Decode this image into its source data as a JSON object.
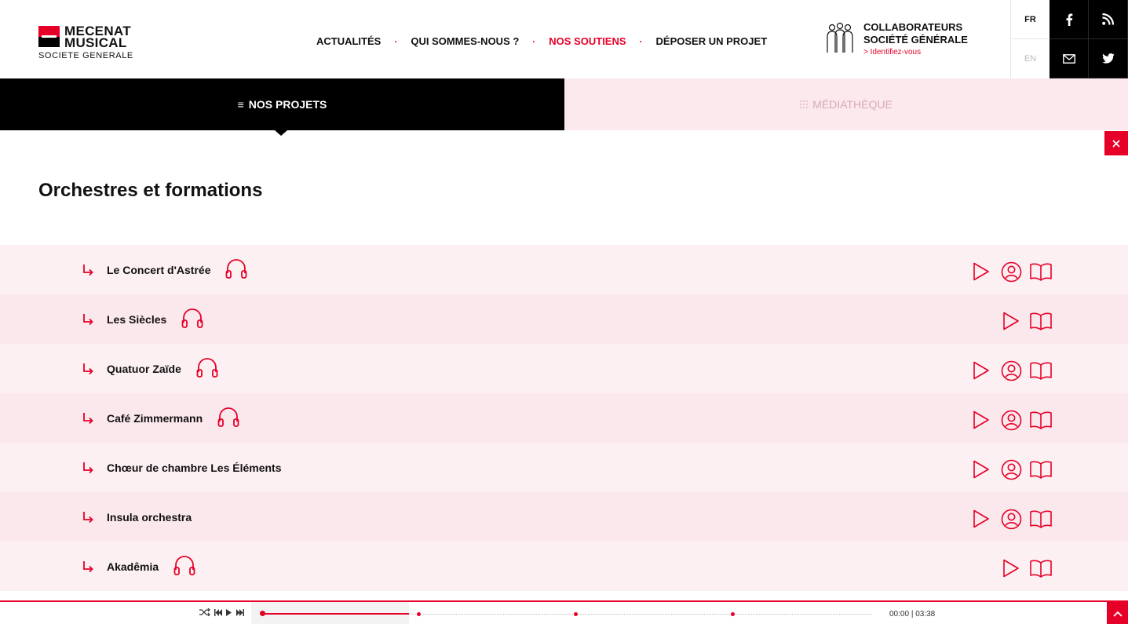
{
  "header": {
    "logo": {
      "line1": "MECENAT",
      "line2": "MUSICAL",
      "line3": "SOCIETE GENERALE"
    },
    "nav": [
      {
        "label": "ACTUALITÉS",
        "active": false
      },
      {
        "label": "QUI SOMMES-NOUS ?",
        "active": false
      },
      {
        "label": "NOS SOUTIENS",
        "active": true
      },
      {
        "label": "DÉPOSER UN PROJET",
        "active": false
      }
    ],
    "nav_separator": "·",
    "collaborateurs": {
      "line1": "COLLABORATEURS",
      "line2": "SOCIÉTÉ GÉNÉRALE",
      "link": "Identifiez-vous"
    },
    "languages": {
      "fr": "FR",
      "en": "EN"
    },
    "social_icons": [
      "facebook-icon",
      "rss-icon",
      "mail-icon",
      "twitter-icon"
    ]
  },
  "tabs": {
    "projets": "NOS PROJETS",
    "mediatheque": "MÉDIATHÈQUE"
  },
  "section": {
    "title": "Orchestres et formations"
  },
  "projects": [
    {
      "name": "Le Concert d'Astrée",
      "audio": true,
      "actions": [
        "video",
        "profile",
        "book"
      ]
    },
    {
      "name": "Les Siècles",
      "audio": true,
      "actions": [
        "video",
        "book"
      ]
    },
    {
      "name": "Quatuor Zaïde",
      "audio": true,
      "actions": [
        "video",
        "profile",
        "book"
      ]
    },
    {
      "name": "Café Zimmermann",
      "audio": true,
      "actions": [
        "video",
        "profile",
        "book"
      ]
    },
    {
      "name": "Chœur de chambre Les Éléments",
      "audio": false,
      "actions": [
        "video",
        "profile",
        "book"
      ]
    },
    {
      "name": "Insula orchestra",
      "audio": false,
      "actions": [
        "video",
        "profile",
        "book"
      ]
    },
    {
      "name": "Akadêmia",
      "audio": true,
      "actions": [
        "video",
        "book"
      ]
    }
  ],
  "player": {
    "controls": [
      "shuffle-icon",
      "previous-icon",
      "play-icon",
      "next-icon"
    ],
    "progress": 0,
    "time_current": "00:00",
    "time_total": "03:38",
    "time_separator": "|"
  },
  "colors": {
    "accent": "#e60028",
    "row_light": "#fdf0f3",
    "row_dark": "#fbe8ed",
    "tab_active": "#000000",
    "tab_inactive": "#fce9ee"
  }
}
